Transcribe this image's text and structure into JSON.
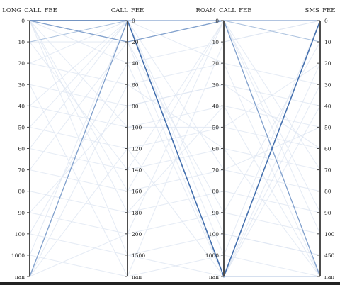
{
  "chart_data": {
    "type": "parallel_coordinates",
    "axes": [
      {
        "name": "LONG_CALL_FEE",
        "ticks": [
          "0",
          "10",
          "20",
          "30",
          "40",
          "50",
          "60",
          "70",
          "80",
          "90",
          "100",
          "1000",
          "nan"
        ]
      },
      {
        "name": "CALL_FEE",
        "ticks": [
          "0",
          "20",
          "40",
          "60",
          "80",
          "100",
          "120",
          "140",
          "160",
          "180",
          "200",
          "1500",
          "nan"
        ]
      },
      {
        "name": "ROAM_CALL_FEE",
        "ticks": [
          "0",
          "10",
          "20",
          "30",
          "40",
          "50",
          "60",
          "70",
          "80",
          "90",
          "100",
          "1000",
          "nan"
        ]
      },
      {
        "name": "SMS_FEE",
        "ticks": [
          "0",
          "10",
          "20",
          "30",
          "40",
          "50",
          "60",
          "70",
          "80",
          "90",
          "100",
          "450",
          "nan"
        ]
      }
    ],
    "records": [
      {
        "values": [
          "0",
          "0",
          "nan",
          "0"
        ],
        "weight": 1.0
      },
      {
        "values": [
          "nan",
          "0",
          "0",
          "nan"
        ],
        "weight": 0.65
      },
      {
        "values": [
          "0",
          "20",
          "0",
          "0"
        ],
        "weight": 0.45
      },
      {
        "values": [
          "0",
          "0",
          "0",
          "nan"
        ],
        "weight": 0.35
      },
      {
        "values": [
          "10",
          "0",
          "0",
          "0"
        ],
        "weight": 0.3
      },
      {
        "values": [
          "0",
          "20",
          "0",
          "10"
        ],
        "weight": 0.25
      },
      {
        "values": [
          "0",
          "0",
          "nan",
          "nan"
        ],
        "weight": 0.22
      },
      {
        "values": [
          "nan",
          "0",
          "0",
          "0"
        ],
        "weight": 0.2
      },
      {
        "values": [
          "0",
          "40",
          "10",
          "0"
        ],
        "weight": 0.12
      },
      {
        "values": [
          "10",
          "20",
          "nan",
          "20"
        ],
        "weight": 0.1
      },
      {
        "values": [
          "20",
          "60",
          "20",
          "30"
        ],
        "weight": 0.08
      },
      {
        "values": [
          "30",
          "80",
          "30",
          "40"
        ],
        "weight": 0.08
      },
      {
        "values": [
          "40",
          "100",
          "40",
          "50"
        ],
        "weight": 0.07
      },
      {
        "values": [
          "50",
          "120",
          "50",
          "60"
        ],
        "weight": 0.07
      },
      {
        "values": [
          "60",
          "140",
          "60",
          "70"
        ],
        "weight": 0.06
      },
      {
        "values": [
          "70",
          "160",
          "70",
          "80"
        ],
        "weight": 0.06
      },
      {
        "values": [
          "80",
          "180",
          "80",
          "90"
        ],
        "weight": 0.06
      },
      {
        "values": [
          "90",
          "200",
          "90",
          "100"
        ],
        "weight": 0.06
      },
      {
        "values": [
          "100",
          "1500",
          "100",
          "450"
        ],
        "weight": 0.06
      },
      {
        "values": [
          "1000",
          "nan",
          "1000",
          "nan"
        ],
        "weight": 0.06
      },
      {
        "values": [
          "20",
          "0",
          "nan",
          "0"
        ],
        "weight": 0.06
      },
      {
        "values": [
          "nan",
          "200",
          "0",
          "100"
        ],
        "weight": 0.06
      },
      {
        "values": [
          "0",
          "100",
          "50",
          "20"
        ],
        "weight": 0.06
      },
      {
        "values": [
          "50",
          "0",
          "20",
          "nan"
        ],
        "weight": 0.06
      },
      {
        "values": [
          "100",
          "40",
          "nan",
          "30"
        ],
        "weight": 0.05
      },
      {
        "values": [
          "0",
          "160",
          "0",
          "70"
        ],
        "weight": 0.05
      },
      {
        "values": [
          "70",
          "20",
          "90",
          "10"
        ],
        "weight": 0.05
      },
      {
        "values": [
          "1000",
          "0",
          "0",
          "0"
        ],
        "weight": 0.05
      },
      {
        "values": [
          "0",
          "0",
          "100",
          "450"
        ],
        "weight": 0.05
      },
      {
        "values": [
          "30",
          "nan",
          "10",
          "0"
        ],
        "weight": 0.05
      },
      {
        "values": [
          "nan",
          "60",
          "60",
          "nan"
        ],
        "weight": 0.05
      },
      {
        "values": [
          "10",
          "140",
          "0",
          "90"
        ],
        "weight": 0.05
      },
      {
        "values": [
          "40",
          "0",
          "1000",
          "0"
        ],
        "weight": 0.05
      },
      {
        "values": [
          "0",
          "1500",
          "nan",
          "nan"
        ],
        "weight": 0.05
      },
      {
        "values": [
          "90",
          "80",
          "30",
          "60"
        ],
        "weight": 0.04
      },
      {
        "values": [
          "nan",
          "120",
          "nan",
          "40"
        ],
        "weight": 0.04
      },
      {
        "values": [
          "60",
          "0",
          "70",
          "50"
        ],
        "weight": 0.04
      },
      {
        "values": [
          "0",
          "180",
          "40",
          "nan"
        ],
        "weight": 0.04
      }
    ]
  }
}
